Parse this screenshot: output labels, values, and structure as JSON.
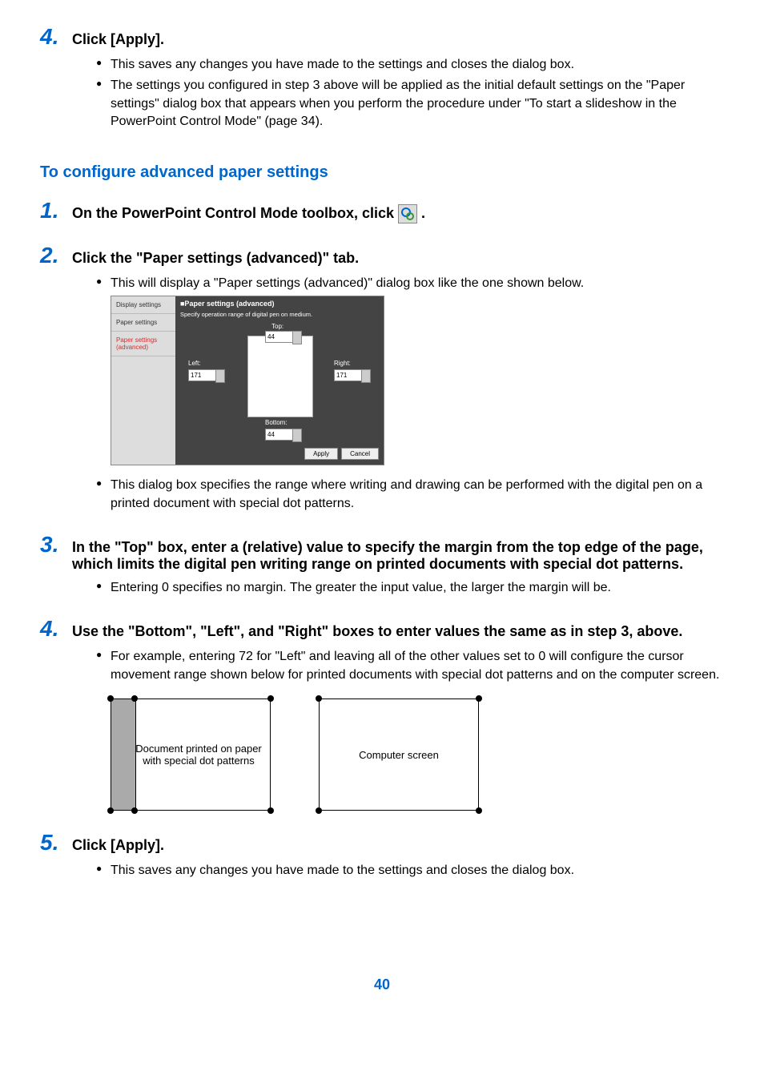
{
  "step4a": {
    "number": "4.",
    "title": "Click [Apply].",
    "bullets": [
      "This saves any changes you have made to the settings and closes the dialog box.",
      "The settings you configured in step 3 above will be applied as the initial default settings on the \"Paper settings\" dialog box that appears when you perform the procedure under \"To start a slideshow in the PowerPoint Control Mode\" (page 34)."
    ]
  },
  "section_title": "To configure advanced paper settings",
  "step1": {
    "number": "1.",
    "title_prefix": "On the PowerPoint Control Mode toolbox, click ",
    "title_suffix": "."
  },
  "step2": {
    "number": "2.",
    "title": "Click the \"Paper settings (advanced)\" tab.",
    "bullets_before": [
      "This will display a \"Paper settings (advanced)\" dialog box like the one shown below."
    ],
    "bullets_after": [
      "This dialog box specifies the range where writing and drawing can be performed with the digital pen on a printed document with special dot patterns."
    ]
  },
  "dialog": {
    "tabs": [
      "Display settings",
      "Paper settings",
      "Paper settings (advanced)"
    ],
    "main_title": "■Paper settings (advanced)",
    "fieldset": "Specify operation range of digital pen on medium.",
    "top_label": "Top:",
    "top_value": "44",
    "left_label": "Left:",
    "left_value": "171",
    "right_label": "Right:",
    "right_value": "171",
    "bottom_label": "Bottom:",
    "bottom_value": "44",
    "apply": "Apply",
    "cancel": "Cancel"
  },
  "step3": {
    "number": "3.",
    "title": "In the \"Top\" box, enter a (relative) value to specify the margin from the top edge of the page, which limits the digital pen writing range on printed documents with special dot patterns.",
    "bullets": [
      "Entering 0 specifies no margin. The greater the input value, the larger the margin will be."
    ]
  },
  "step4b": {
    "number": "4.",
    "title": "Use the \"Bottom\", \"Left\", and \"Right\" boxes to enter values the same as in step 3, above.",
    "bullets": [
      "For example, entering 72 for \"Left\" and leaving all of the other values set to 0 will configure the cursor movement range shown below for printed documents with special dot patterns and on the computer screen."
    ]
  },
  "diagram": {
    "left_caption": "Document printed on paper with special dot patterns",
    "right_caption": "Computer screen"
  },
  "step5": {
    "number": "5.",
    "title": "Click [Apply].",
    "bullets": [
      "This saves any changes you have made to the settings and closes the dialog box."
    ]
  },
  "page_number": "40"
}
